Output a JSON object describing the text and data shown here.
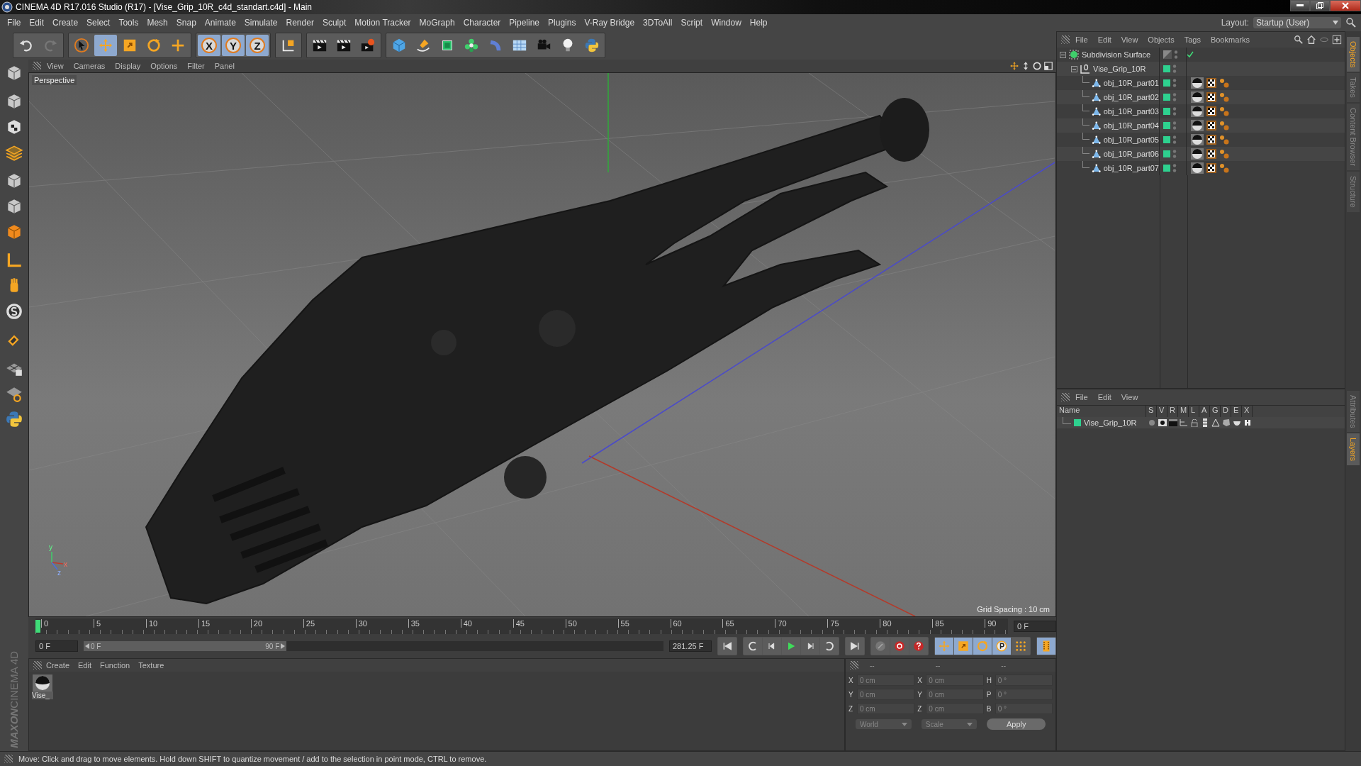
{
  "window": {
    "title": "CINEMA 4D R17.016 Studio (R17) - [Vise_Grip_10R_c4d_standart.c4d] - Main"
  },
  "menu": [
    "File",
    "Edit",
    "Create",
    "Select",
    "Tools",
    "Mesh",
    "Snap",
    "Animate",
    "Simulate",
    "Render",
    "Sculpt",
    "Motion Tracker",
    "MoGraph",
    "Character",
    "Pipeline",
    "Plugins",
    "V-Ray Bridge",
    "3DToAll",
    "Script",
    "Window",
    "Help"
  ],
  "layout": {
    "label": "Layout:",
    "value": "Startup (User)"
  },
  "toolbar": {
    "axis_locks": [
      {
        "label": "X",
        "on": true
      },
      {
        "label": "Y",
        "on": true
      },
      {
        "label": "Z",
        "on": true
      }
    ]
  },
  "viewport": {
    "menu": [
      "View",
      "Cameras",
      "Display",
      "Options",
      "Filter",
      "Panel"
    ],
    "camera": "Perspective",
    "grid_spacing": "Grid Spacing : 10 cm",
    "gizmo_labels": [
      "y",
      "x",
      "z"
    ]
  },
  "timeline": {
    "ticks": [
      "0",
      "5",
      "10",
      "15",
      "20",
      "25",
      "30",
      "35",
      "40",
      "45",
      "50",
      "55",
      "60",
      "65",
      "70",
      "75",
      "80",
      "85",
      "90"
    ],
    "current_frame": "0 F",
    "start": "0 F",
    "range_start": "0 F",
    "range_end": "90 F",
    "range": {
      "level": 0.35
    },
    "end": "281.25 F"
  },
  "materials": {
    "menu": [
      "Create",
      "Edit",
      "Function",
      "Texture"
    ],
    "items": [
      {
        "name": "Vise_"
      }
    ]
  },
  "coordinates": {
    "headers": [
      "--",
      "--",
      "--"
    ],
    "columns": [
      [
        {
          "axis": "X",
          "value": "0 cm"
        },
        {
          "axis": "Y",
          "value": "0 cm"
        },
        {
          "axis": "Z",
          "value": "0 cm"
        }
      ],
      [
        {
          "axis": "X",
          "value": "0 cm"
        },
        {
          "axis": "Y",
          "value": "0 cm"
        },
        {
          "axis": "Z",
          "value": "0 cm"
        }
      ],
      [
        {
          "axis": "H",
          "value": "0 °"
        },
        {
          "axis": "P",
          "value": "0 °"
        },
        {
          "axis": "B",
          "value": "0 °"
        }
      ]
    ],
    "dropdowns": [
      "World",
      "Scale"
    ],
    "apply": "Apply"
  },
  "objects": {
    "menu": [
      "File",
      "Edit",
      "View",
      "Objects",
      "Tags",
      "Bookmarks"
    ],
    "tree": [
      {
        "name": "Subdivision Surface",
        "kind": "generator",
        "expanded": true,
        "children": [
          {
            "name": "Vise_Grip_10R",
            "kind": "null",
            "expanded": true,
            "children": [
              {
                "name": "obj_10R_part01",
                "kind": "polygon"
              },
              {
                "name": "obj_10R_part02",
                "kind": "polygon"
              },
              {
                "name": "obj_10R_part03",
                "kind": "polygon"
              },
              {
                "name": "obj_10R_part04",
                "kind": "polygon"
              },
              {
                "name": "obj_10R_part05",
                "kind": "polygon"
              },
              {
                "name": "obj_10R_part06",
                "kind": "polygon"
              },
              {
                "name": "obj_10R_part07",
                "kind": "polygon"
              }
            ]
          }
        ]
      }
    ]
  },
  "layers": {
    "menu": [
      "File",
      "Edit",
      "View"
    ],
    "columns": [
      "Name",
      "S",
      "V",
      "R",
      "M",
      "L",
      "A",
      "G",
      "D",
      "E",
      "X"
    ],
    "rows": [
      {
        "name": "Vise_Grip_10R",
        "color": "#2ed18f"
      }
    ]
  },
  "side_tabs": [
    {
      "label": "Objects",
      "selected": true
    },
    {
      "label": "Takes",
      "selected": false
    },
    {
      "label": "Content Browser",
      "selected": false
    },
    {
      "label": "Structure",
      "selected": false
    }
  ],
  "side_tabs_lower": [
    {
      "label": "Attributes",
      "selected": false
    },
    {
      "label": "Layers",
      "selected": true
    }
  ],
  "brand": [
    "MAXON",
    "CINEMA 4D"
  ],
  "status_bar": "Move: Click and drag to move elements. Hold down SHIFT to quantize movement / add to the selection in point mode, CTRL to remove."
}
